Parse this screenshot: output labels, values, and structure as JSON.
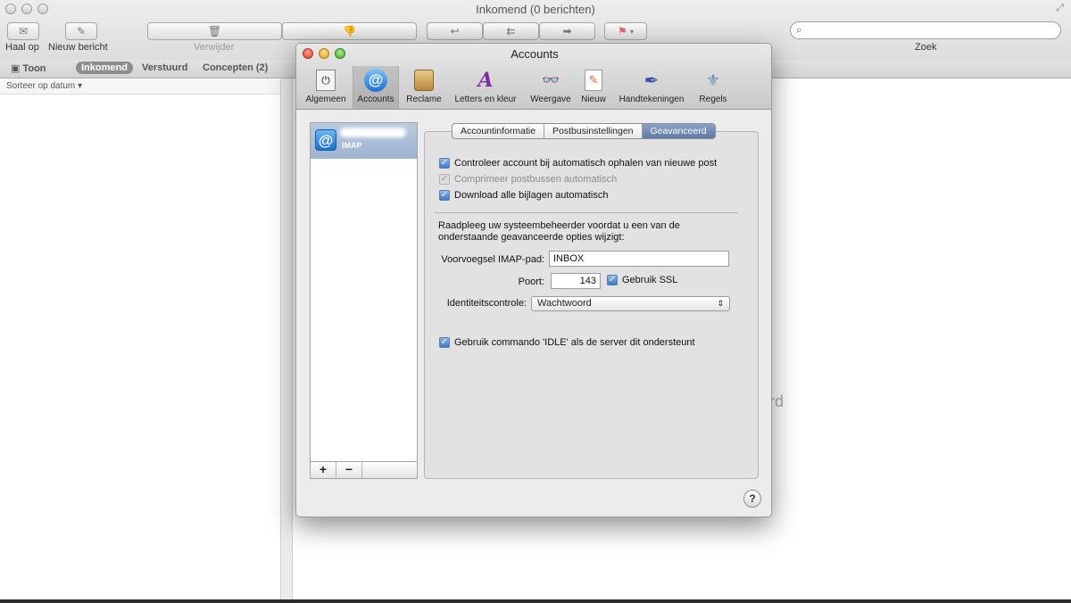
{
  "window": {
    "title": "Inkomend (0 berichten)"
  },
  "toolbar": {
    "get_mail": "Haal op",
    "new_message": "Nieuw bericht",
    "delete": "Verwijder",
    "search_label": "Zoek"
  },
  "favorites": {
    "show": "Toon",
    "items": [
      "Inkomend",
      "Verstuurd",
      "Concepten (2)"
    ]
  },
  "list": {
    "sort": "Sorteer op datum ▾"
  },
  "preview": {
    "partial_text": "rd"
  },
  "prefs": {
    "title": "Accounts",
    "toolbar": [
      {
        "label": "Algemeen",
        "icon": "switch-icon"
      },
      {
        "label": "Accounts",
        "icon": "at-icon"
      },
      {
        "label": "Reclame",
        "icon": "junk-bin-icon"
      },
      {
        "label": "Letters en kleur",
        "icon": "fonts-colors-icon"
      },
      {
        "label": "Weergave",
        "icon": "glasses-icon"
      },
      {
        "label": "Nieuw",
        "icon": "compose-icon"
      },
      {
        "label": "Handtekeningen",
        "icon": "signature-icon"
      },
      {
        "label": "Regels",
        "icon": "rules-icon"
      }
    ],
    "account": {
      "type": "IMAP"
    },
    "tabs": [
      "Accountinformatie",
      "Postbusinstellingen",
      "Geavanceerd"
    ],
    "options": {
      "check_auto": "Controleer account bij automatisch ophalen van nieuwe post",
      "compact_auto": "Comprimeer postbussen automatisch",
      "download_attachments": "Download alle bijlagen automatisch"
    },
    "warning": "Raadpleeg uw systeembeheerder voordat u een van de onderstaande geavanceerde opties wijzigt:",
    "imap_prefix_label": "Voorvoegsel IMAP-pad:",
    "imap_prefix_value": "INBOX",
    "port_label": "Poort:",
    "port_value": "143",
    "ssl_label": "Gebruik SSL",
    "auth_label": "Identiteitscontrole:",
    "auth_value": "Wachtwoord",
    "idle_label": "Gebruik commando 'IDLE' als de server dit ondersteunt",
    "help": "?"
  },
  "colors": {
    "selection": "#5e7aa8",
    "accent": "#3f78c8"
  }
}
